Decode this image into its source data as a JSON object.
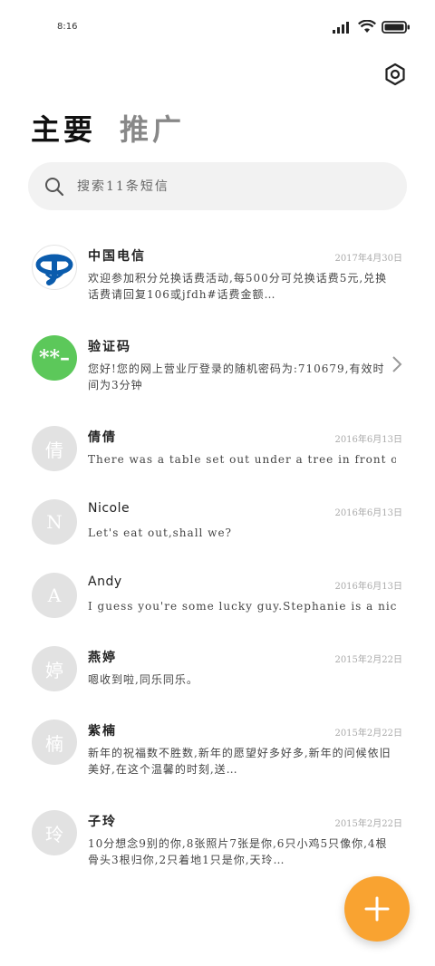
{
  "status": {
    "time": "8:16",
    "icons": [
      "signal-icon",
      "wifi-icon",
      "battery-icon"
    ]
  },
  "header": {
    "settings_icon": "gear-icon",
    "tabs": [
      {
        "label": "主要",
        "active": true
      },
      {
        "label": "推广",
        "active": false
      }
    ]
  },
  "search": {
    "placeholder": "搜索11条短信",
    "icon": "search-icon"
  },
  "conversations": [
    {
      "name": "中国电信",
      "date": "2017年4月30日",
      "preview": "欢迎参加积分兑换话费活动,每500分可兑换话费5元,兑换话费请回复106或jfdh#话费金额…",
      "avatar": "",
      "avatar_type": "logo"
    },
    {
      "name": "验证码",
      "date": "",
      "preview": "您好!您的网上营业厅登录的随机密码为:710679,有效时间为3分钟",
      "avatar": "**–",
      "avatar_type": "green"
    },
    {
      "name": "倩倩",
      "date": "2016年6月13日",
      "preview": "There was a table set out under a tree in front of the house",
      "avatar": "倩",
      "avatar_type": "gray"
    },
    {
      "name": "Nicole",
      "date": "2016年6月13日",
      "preview": "Let's eat out,shall we?",
      "avatar": "N",
      "avatar_type": "gray"
    },
    {
      "name": "Andy",
      "date": "2016年6月13日",
      "preview": "I guess you're some lucky guy.Stephanie is a nice girl",
      "avatar": "A",
      "avatar_type": "gray"
    },
    {
      "name": "燕婷",
      "date": "2015年2月22日",
      "preview": "嗯收到啦,同乐同乐。",
      "avatar": "婷",
      "avatar_type": "gray"
    },
    {
      "name": "紫楠",
      "date": "2015年2月22日",
      "preview": "新年的祝福数不胜数,新年的愿望好多好多,新年的问候依旧美好,在这个温馨的时刻,送…",
      "avatar": "楠",
      "avatar_type": "gray"
    },
    {
      "name": "子玲",
      "date": "2015年2月22日",
      "preview": "10分想念9别的你,8张照片7张是你,6只小鸡5只像你,4根骨头3根归你,2只着地1只是你,天玲…",
      "avatar": "玲",
      "avatar_type": "gray"
    }
  ],
  "fab": {
    "icon": "plus-icon"
  },
  "colors": {
    "accent": "#f9a331",
    "green_avatar": "#5cc85a",
    "telecom_blue": "#0b5cad"
  }
}
